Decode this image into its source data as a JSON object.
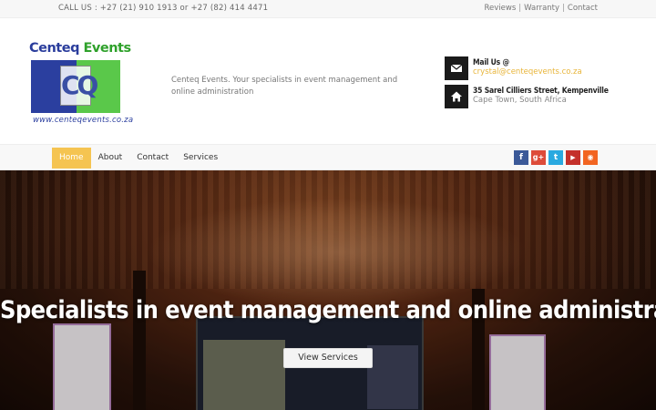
{
  "topbar": {
    "call": "CALL US : +27 (21) 910 1913 or +27 (82) 414 4471",
    "links": [
      "Reviews",
      "Warranty",
      "Contact"
    ],
    "separator": "|"
  },
  "logo": {
    "brand_part1": "Centeq",
    "brand_part2": "Events",
    "monogram": "CQ",
    "url": "www.centeqevents.co.za"
  },
  "tagline": "Centeq Events. Your specialists in event management and online administration",
  "contact": {
    "mail_title": "Mail Us @",
    "mail_value": "crystal@centeqevents.co.za",
    "address_title": "35 Sarel Cilliers Street, Kempenville",
    "address_value": "Cape Town, South Africa"
  },
  "nav": {
    "items": [
      "Home",
      "About",
      "Contact",
      "Services"
    ],
    "active": "Home"
  },
  "social": [
    {
      "icon": "facebook-icon",
      "glyph": "f",
      "color": "#3b5998"
    },
    {
      "icon": "google-plus-icon",
      "glyph": "g+",
      "color": "#dd4b39"
    },
    {
      "icon": "twitter-icon",
      "glyph": "t",
      "color": "#2aa9e0"
    },
    {
      "icon": "youtube-icon",
      "glyph": "▶",
      "color": "#c4302b"
    },
    {
      "icon": "rss-icon",
      "glyph": "◉",
      "color": "#f26522"
    }
  ],
  "hero": {
    "headline": "Specialists in event management and online administration",
    "button": "View Services"
  }
}
